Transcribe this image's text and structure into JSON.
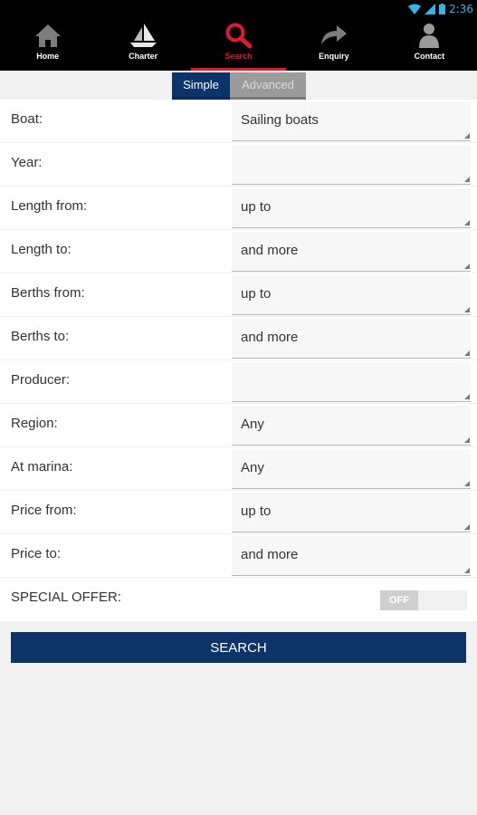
{
  "status_bar": {
    "time": "2:36"
  },
  "nav": {
    "items": [
      {
        "label": "Home",
        "icon": "home-icon"
      },
      {
        "label": "Charter",
        "icon": "sailboat-icon"
      },
      {
        "label": "Search",
        "icon": "search-icon",
        "active": true
      },
      {
        "label": "Enquiry",
        "icon": "share-arrow-icon"
      },
      {
        "label": "Contact",
        "icon": "person-icon"
      }
    ],
    "active_color": "#e0192c"
  },
  "segmented": {
    "simple_label": "Simple",
    "advanced_label": "Advanced",
    "selected": "Simple"
  },
  "form": {
    "fields": [
      {
        "label": "Boat:",
        "value": "Sailing boats"
      },
      {
        "label": "Year:",
        "value": ""
      },
      {
        "label": "Length from:",
        "value": "up to"
      },
      {
        "label": "Length to:",
        "value": "and more"
      },
      {
        "label": "Berths from:",
        "value": "up to"
      },
      {
        "label": "Berths to:",
        "value": "and more"
      },
      {
        "label": "Producer:",
        "value": ""
      },
      {
        "label": "Region:",
        "value": "Any"
      },
      {
        "label": "At marina:",
        "value": "Any"
      },
      {
        "label": "Price from:",
        "value": "up to"
      },
      {
        "label": "Price to:",
        "value": "and more"
      }
    ],
    "special_offer": {
      "label": "SPECIAL OFFER:",
      "toggle_text": "OFF",
      "on": false
    }
  },
  "search_button": {
    "label": "SEARCH"
  },
  "colors": {
    "primary": "#0d3468",
    "background": "#f1f1f1",
    "accent": "#e0192c"
  }
}
